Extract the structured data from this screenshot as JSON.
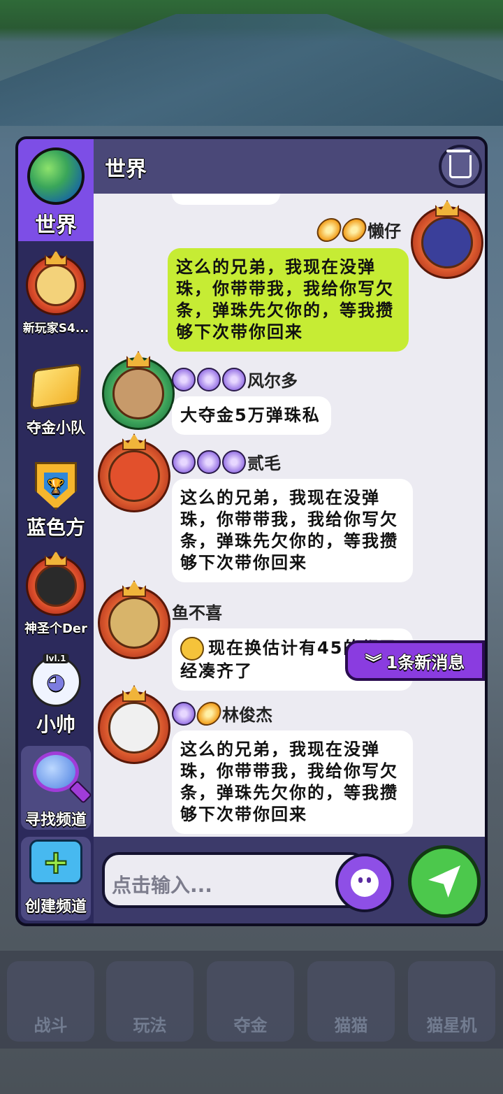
{
  "sidebar": {
    "items": [
      {
        "label": "世界",
        "active": true,
        "icon": "globe-icon"
      },
      {
        "label": "新玩家S4...",
        "icon": "badge-icon"
      },
      {
        "label": "夺金小队",
        "icon": "gold-icon"
      },
      {
        "label": "蓝色方",
        "icon": "trophy-shield-icon"
      },
      {
        "label": "神圣个Der",
        "icon": "badge-icon"
      },
      {
        "label": "小帅",
        "level": "lvl.1",
        "icon": "cat-avatar-icon"
      }
    ],
    "find_channel": "寻找频道",
    "create_channel": "创建频道"
  },
  "chat": {
    "title": "世界",
    "messages": [
      {
        "user": "懒仔",
        "text": "这么的兄弟，我现在没弹珠，你带带我，我给你写欠条，弹珠先欠你的，等我攒够下次带你回来",
        "mine": true
      },
      {
        "user": "风尔多",
        "text": "大夺金5万弹珠私"
      },
      {
        "user": "贰毛",
        "text": "这么的兄弟，我现在没弹珠，你带带我，我给你写欠条，弹珠先欠你的，等我攒够下次带你回来"
      },
      {
        "user": "鱼不喜",
        "text": "现在换估计有45的都已经凑齐了"
      },
      {
        "user": "林俊杰",
        "text": "这么的兄弟，我现在没弹珠，你带带我，我给你写欠条，弹珠先欠你的，等我攒够下次带你回来"
      }
    ],
    "new_messages": "1条新消息"
  },
  "input": {
    "placeholder": "点击输入..."
  },
  "background_tabs": [
    "战斗",
    "玩法",
    "夺金",
    "猫猫",
    "猫星机"
  ]
}
